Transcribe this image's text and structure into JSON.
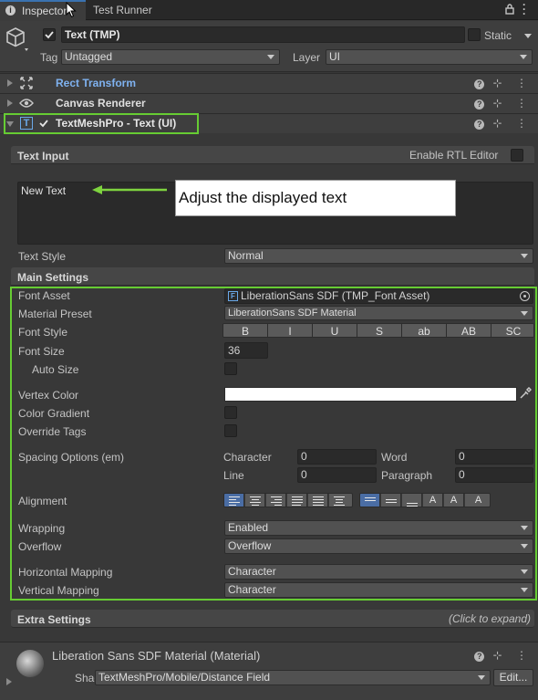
{
  "tabs": {
    "inspector_label": "Inspector",
    "test_runner_label": "Test Runner"
  },
  "object": {
    "name": "Text (TMP)",
    "static_label": "Static",
    "tag_label": "Tag",
    "tag_value": "Untagged",
    "layer_label": "Layer",
    "layer_value": "UI"
  },
  "components": {
    "rect_transform": "Rect Transform",
    "canvas_renderer": "Canvas Renderer",
    "textmeshpro": "TextMeshPro - Text (UI)"
  },
  "text_input": {
    "header": "Text Input",
    "rtl_label": "Enable RTL Editor",
    "value": "New Text",
    "callout": "Adjust the displayed text",
    "text_style_label": "Text Style",
    "text_style_value": "Normal"
  },
  "main_settings": {
    "header": "Main Settings",
    "font_asset_label": "Font Asset",
    "font_asset_value": "LiberationSans SDF (TMP_Font Asset)",
    "material_preset_label": "Material Preset",
    "material_preset_value": "LiberationSans SDF Material",
    "font_style_label": "Font Style",
    "font_style_buttons": [
      "B",
      "I",
      "U",
      "S",
      "ab",
      "AB",
      "SC"
    ],
    "font_size_label": "Font Size",
    "font_size_value": "36",
    "auto_size_label": "Auto Size",
    "vertex_color_label": "Vertex Color",
    "color_gradient_label": "Color Gradient",
    "override_tags_label": "Override Tags",
    "spacing_label": "Spacing Options (em)",
    "character_label": "Character",
    "character_value": "0",
    "word_label": "Word",
    "word_value": "0",
    "line_label": "Line",
    "line_value": "0",
    "paragraph_label": "Paragraph",
    "paragraph_value": "0",
    "alignment_label": "Alignment",
    "wrapping_label": "Wrapping",
    "wrapping_value": "Enabled",
    "overflow_label": "Overflow",
    "overflow_value": "Overflow",
    "horizontal_mapping_label": "Horizontal Mapping",
    "horizontal_mapping_value": "Character",
    "vertical_mapping_label": "Vertical Mapping",
    "vertical_mapping_value": "Character"
  },
  "extra_settings": {
    "header": "Extra Settings",
    "hint": "(Click to expand)"
  },
  "material": {
    "name": "Liberation Sans SDF Material (Material)",
    "shader_label": "Shader",
    "shader_value": "TextMeshPro/Mobile/Distance Field",
    "edit_label": "Edit..."
  },
  "colors": {
    "highlight": "#66cc33",
    "link": "#7fb2f0",
    "panel": "#383838",
    "active_toggle": "#4a6da4"
  }
}
